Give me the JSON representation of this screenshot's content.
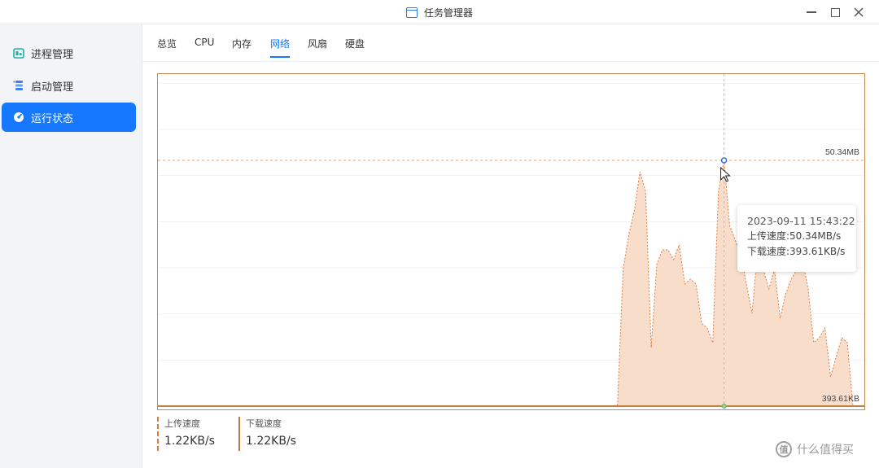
{
  "window": {
    "title": "任务管理器",
    "icon": "window-app-icon"
  },
  "sidebar": {
    "items": [
      {
        "label": "进程管理",
        "icon": "process-icon",
        "active": false
      },
      {
        "label": "启动管理",
        "icon": "startup-icon",
        "active": false
      },
      {
        "label": "运行状态",
        "icon": "status-icon",
        "active": true
      }
    ]
  },
  "tabs": [
    {
      "label": "总览",
      "active": false
    },
    {
      "label": "CPU",
      "active": false
    },
    {
      "label": "内存",
      "active": false
    },
    {
      "label": "网络",
      "active": true
    },
    {
      "label": "风扇",
      "active": false
    },
    {
      "label": "硬盘",
      "active": false
    }
  ],
  "chart_data": {
    "type": "area",
    "max_label": "50.34MB",
    "min_label": "393.61KB",
    "series": [
      {
        "name": "上传速度",
        "color": "#e07a3f",
        "values": [
          0,
          0,
          0,
          0,
          0,
          0,
          0,
          0,
          0,
          0,
          0,
          0,
          0,
          0,
          0,
          0,
          0,
          0,
          0,
          0,
          0,
          0,
          0,
          0,
          0,
          0,
          0,
          0,
          0,
          0,
          0,
          0,
          0,
          0,
          0,
          0,
          0,
          0,
          0,
          0,
          0,
          0,
          0,
          0,
          0,
          0,
          0,
          0,
          0,
          0,
          0,
          0,
          0,
          0,
          0,
          0,
          0,
          0,
          0,
          0,
          0,
          0,
          0,
          0,
          0,
          0,
          0,
          0,
          0,
          0,
          0,
          0,
          0,
          0,
          0,
          0,
          0,
          0,
          0,
          0,
          0,
          0,
          0.28,
          28,
          35,
          40,
          48,
          44,
          12,
          29,
          32,
          32,
          30,
          33,
          25,
          26,
          25,
          17,
          16,
          13,
          44,
          50.34,
          37,
          34,
          31,
          25,
          19,
          32,
          28,
          24,
          28,
          18,
          23,
          26,
          28,
          30,
          24,
          13,
          14,
          16,
          6,
          10,
          14,
          13,
          0
        ]
      },
      {
        "name": "下载速度",
        "color": "#c08040",
        "values": []
      }
    ],
    "ylim": [
      0,
      68
    ],
    "grid": true
  },
  "tooltip": {
    "time": "2023-09-11 15:43:22",
    "upload": "上传速度:50.34MB/s",
    "download": "下载速度:393.61KB/s"
  },
  "legend": {
    "upload": {
      "title": "上传速度",
      "value": "1.22KB/s",
      "color": "#e07a3f"
    },
    "download": {
      "title": "下载速度",
      "value": "1.22KB/s",
      "color": "#b8793d"
    }
  },
  "watermark": {
    "text": "什么值得买",
    "icon_text": "值"
  }
}
